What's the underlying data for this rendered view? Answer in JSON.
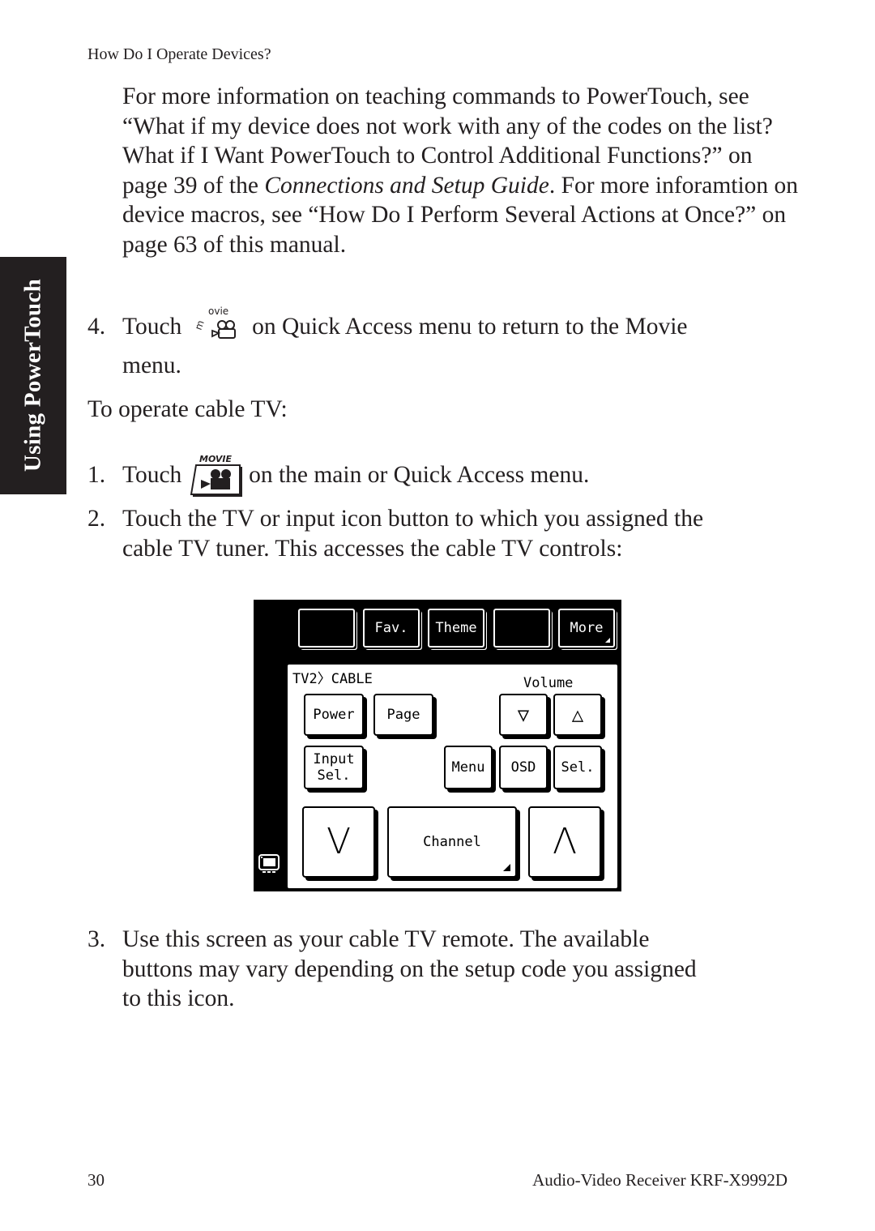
{
  "running_head": "How Do I Operate Devices?",
  "side_tab": "Using PowerTouch",
  "para1": {
    "part1": "For more information on teaching commands to PowerTouch, see “What if my device does not work with any of the codes on the list? What if I Want PowerTouch to Control Additional Functions?” on page 39 of the ",
    "italic": "Connections and Setup Guide",
    "part2": ". For more inforamtion on device macros, see “How Do I Perform Several Actions at Once?” on page 63 of this manual."
  },
  "step4": {
    "num": "4.",
    "before": "Touch",
    "icon": "movie-quick-access-icon",
    "icon_label": "movie",
    "after": "on Quick Access menu to return to the Movie",
    "line2": "menu."
  },
  "section_intro": "To operate cable TV:",
  "steps": [
    {
      "num": "1.",
      "before": "Touch",
      "icon": "movie-button-icon",
      "icon_label": "MOVIE",
      "after": "on the main or Quick Access menu."
    },
    {
      "num": "2.",
      "line1": "Touch the TV or input icon button to which you assigned the",
      "line2": "cable TV tuner. This accesses the cable TV controls:"
    },
    {
      "num": "3.",
      "line1": "Use this screen as your cable TV remote. The available",
      "line2": "buttons may vary depending on the setup code you assigned",
      "line3": "to this icon."
    }
  ],
  "remote_screen": {
    "top_buttons": [
      "",
      "Fav.",
      "Theme",
      "",
      "More"
    ],
    "breadcrumb": "TV2〉CABLE",
    "volume_label": "Volume",
    "buttons": {
      "power": "Power",
      "page": "Page",
      "volume_down": "▽",
      "volume_up": "△",
      "input_sel": "Input\nSel.",
      "menu": "Menu",
      "osd": "OSD",
      "sel": "Sel.",
      "channel_down": "V",
      "channel": "Channel",
      "channel_up": "Λ"
    },
    "device_icon": "tv-icon"
  },
  "footer": {
    "page_number": "30",
    "product": "Audio-Video Receiver KRF-X9992D"
  }
}
